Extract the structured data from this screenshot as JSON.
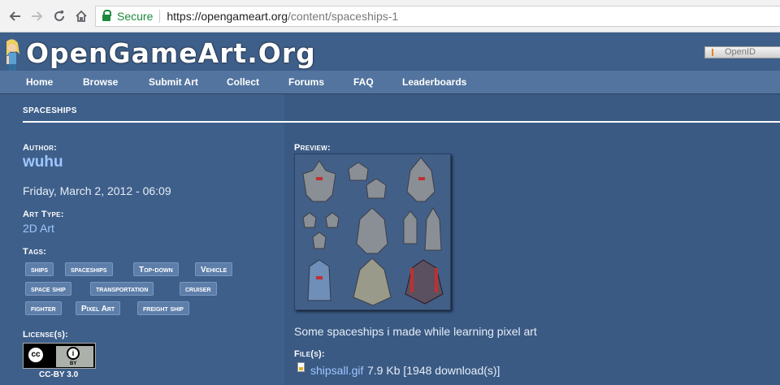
{
  "browser": {
    "back_icon": "back-arrow-icon",
    "forward_icon": "forward-arrow-icon",
    "reload_icon": "reload-icon",
    "home_icon": "home-icon",
    "secure_label": "Secure",
    "url_host": "https://opengameart.org",
    "url_path": "/content/spaceships-1"
  },
  "site": {
    "logo": "OpenGameArt.Org",
    "openid_label": "OpenID",
    "menu": [
      "Home",
      "Browse",
      "Submit Art",
      "Collect",
      "Forums",
      "FAQ",
      "Leaderboards"
    ]
  },
  "page": {
    "title": "SPACESHIPS",
    "author_label": "Author:",
    "author": "wuhu",
    "date": "Friday, March 2, 2012 - 06:09",
    "art_type_label": "Art Type:",
    "art_type": "2D Art",
    "tags_label": "Tags:",
    "tags": [
      "ships",
      "spaceships",
      "Top-down",
      "Vehicle",
      "space ship",
      "transportation",
      "cruiser",
      "fighter",
      "Pixel Art",
      "freight ship"
    ],
    "license_label": "License(s):",
    "license": "CC-BY 3.0",
    "cc_badge_cc": "cc",
    "cc_badge_by": "BY",
    "preview_label": "Preview:",
    "description": "Some spaceships i made while learning pixel art",
    "files_label": "File(s):",
    "file_name": "shipsall.gif",
    "file_info": "7.9 Kb [1948 download(s)]"
  },
  "colors": {
    "background": "#3e5f8a",
    "menubar": "#53749f",
    "link": "#9fc6ff",
    "secure": "#1a8a3c"
  }
}
